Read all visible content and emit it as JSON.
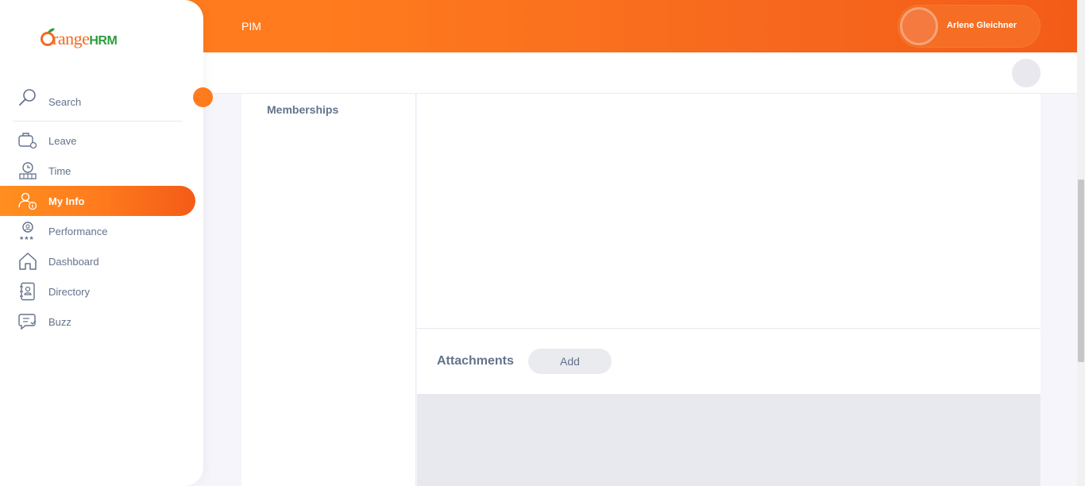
{
  "brand": {
    "logo_main": "range",
    "logo_suffix": "HRM"
  },
  "topbar": {
    "title": "PIM",
    "user_name": "Arlene Gleichner"
  },
  "sidebar": {
    "search_label": "Search",
    "items": [
      {
        "label": "Leave",
        "icon": "leave-icon",
        "active": false
      },
      {
        "label": "Time",
        "icon": "time-icon",
        "active": false
      },
      {
        "label": "My Info",
        "icon": "my-info-icon",
        "active": true
      },
      {
        "label": "Performance",
        "icon": "performance-icon",
        "active": false
      },
      {
        "label": "Dashboard",
        "icon": "dashboard-icon",
        "active": false
      },
      {
        "label": "Directory",
        "icon": "directory-icon",
        "active": false
      },
      {
        "label": "Buzz",
        "icon": "buzz-icon",
        "active": false
      }
    ]
  },
  "main": {
    "left_menu": {
      "memberships": "Memberships"
    },
    "attachments": {
      "title": "Attachments",
      "add_label": "Add"
    }
  },
  "colors": {
    "accent": "#ff7b1d",
    "accent_dark": "#f35c17",
    "text": "#64728c",
    "brand_green": "#2d9c3c"
  }
}
